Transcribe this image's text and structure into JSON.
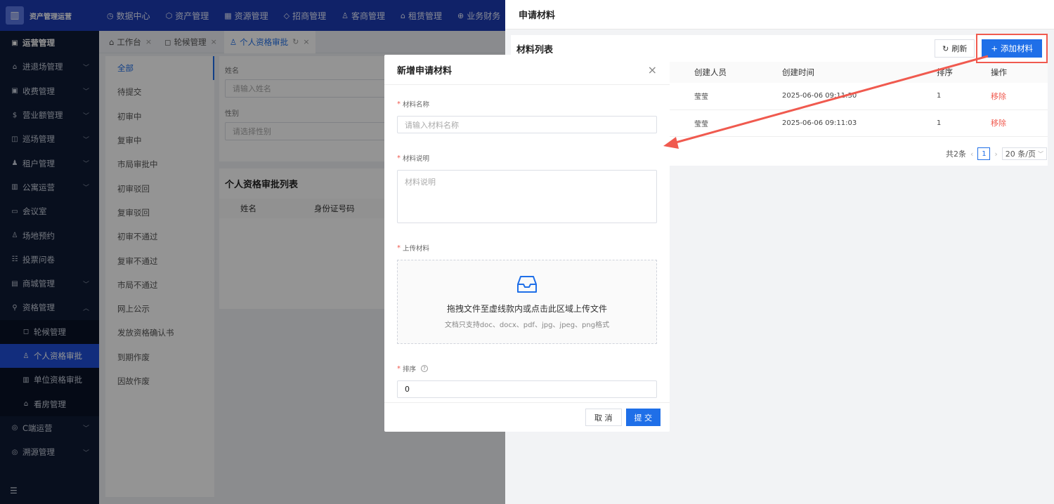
{
  "app": {
    "title": "资产管理运营"
  },
  "topnav": [
    {
      "icon": "◷",
      "label": "数据中心"
    },
    {
      "icon": "⬡",
      "label": "资产管理"
    },
    {
      "icon": "▦",
      "label": "资源管理"
    },
    {
      "icon": "◇",
      "label": "招商管理"
    },
    {
      "icon": "♙",
      "label": "客商管理"
    },
    {
      "icon": "⌂",
      "label": "租赁管理"
    },
    {
      "icon": "⊕",
      "label": "业务财务"
    }
  ],
  "sidebar": {
    "title": "运营管理",
    "items": [
      {
        "icon": "⌂",
        "label": "进退场管理",
        "chevron": "﹀"
      },
      {
        "icon": "▣",
        "label": "收费管理",
        "chevron": "﹀"
      },
      {
        "icon": "$",
        "label": "营业额管理",
        "chevron": "﹀"
      },
      {
        "icon": "◫",
        "label": "巡场管理",
        "chevron": "﹀"
      },
      {
        "icon": "♟",
        "label": "租户管理",
        "chevron": "﹀"
      },
      {
        "icon": "▥",
        "label": "公寓运营",
        "chevron": "﹀"
      },
      {
        "icon": "▭",
        "label": "会议室",
        "chevron": ""
      },
      {
        "icon": "♙",
        "label": "场地预约",
        "chevron": ""
      },
      {
        "icon": "☷",
        "label": "投票问卷",
        "chevron": ""
      },
      {
        "icon": "▤",
        "label": "商城管理",
        "chevron": "﹀"
      },
      {
        "icon": "⚲",
        "label": "资格管理",
        "chevron": "︿"
      }
    ],
    "sub_items": [
      {
        "icon": "◻",
        "label": "轮候管理"
      },
      {
        "icon": "♙",
        "label": "个人资格审批"
      },
      {
        "icon": "▥",
        "label": "单位资格审批"
      },
      {
        "icon": "⌂",
        "label": "看房管理"
      }
    ],
    "after_items": [
      {
        "icon": "◎",
        "label": "C端运营",
        "chevron": "﹀"
      },
      {
        "icon": "◎",
        "label": "溯源管理",
        "chevron": "﹀"
      }
    ],
    "collapse_icon": "☰"
  },
  "tabs": [
    {
      "icon": "⌂",
      "label": "工作台",
      "close": "×"
    },
    {
      "icon": "◻",
      "label": "轮候管理",
      "close": "×"
    },
    {
      "icon": "♙",
      "label": "个人资格审批",
      "close": "×",
      "refresh": "↻"
    }
  ],
  "status_list": [
    "全部",
    "待提交",
    "初审中",
    "复审中",
    "市局审批中",
    "初审驳回",
    "复审驳回",
    "初审不通过",
    "复审不通过",
    "市局不通过",
    "网上公示",
    "发放资格确认书",
    "到期作废",
    "因故作废"
  ],
  "filters": {
    "name_label": "姓名",
    "name_placeholder": "请输入姓名",
    "gender_label": "性别",
    "gender_placeholder": "请选择性别"
  },
  "approval_list": {
    "title": "个人资格审批列表",
    "columns": [
      "姓名",
      "身份证号码"
    ]
  },
  "drawer": {
    "title": "申请材料",
    "list_title": "材料列表",
    "refresh_label": "刷新",
    "add_label": "添加材料",
    "columns": [
      "创建人员",
      "创建时间",
      "排序",
      "操作"
    ],
    "rows": [
      {
        "creator": "莹莹",
        "time": "2025-06-06 09:11:30",
        "order": "1",
        "action": "移除"
      },
      {
        "creator": "莹莹",
        "time": "2025-06-06 09:11:03",
        "order": "1",
        "action": "移除"
      }
    ],
    "pager": {
      "total": "共2条",
      "current": "1",
      "page_size": "20 条/页",
      "prev": "‹",
      "next": "›"
    }
  },
  "modal": {
    "title": "新增申请材料",
    "close": "×",
    "required_mark": "*",
    "fields": {
      "name_label": "材料名称",
      "name_placeholder": "请输入材料名称",
      "desc_label": "材料说明",
      "desc_placeholder": "材料说明",
      "upload_label": "上传材料",
      "upload_main": "拖拽文件至虚线款内或点击此区域上传文件",
      "upload_sub": "文档只支持doc、docx、pdf、jpg、jpeg、png格式",
      "order_label": "排序",
      "order_value": "0",
      "order_help": "?"
    },
    "cancel_label": "取 消",
    "submit_label": "提 交"
  },
  "colors": {
    "primary": "#1f6fe8",
    "annotation": "#f05a4f",
    "topbar": "#1d3bb3",
    "sidebar": "#0f1a34"
  }
}
